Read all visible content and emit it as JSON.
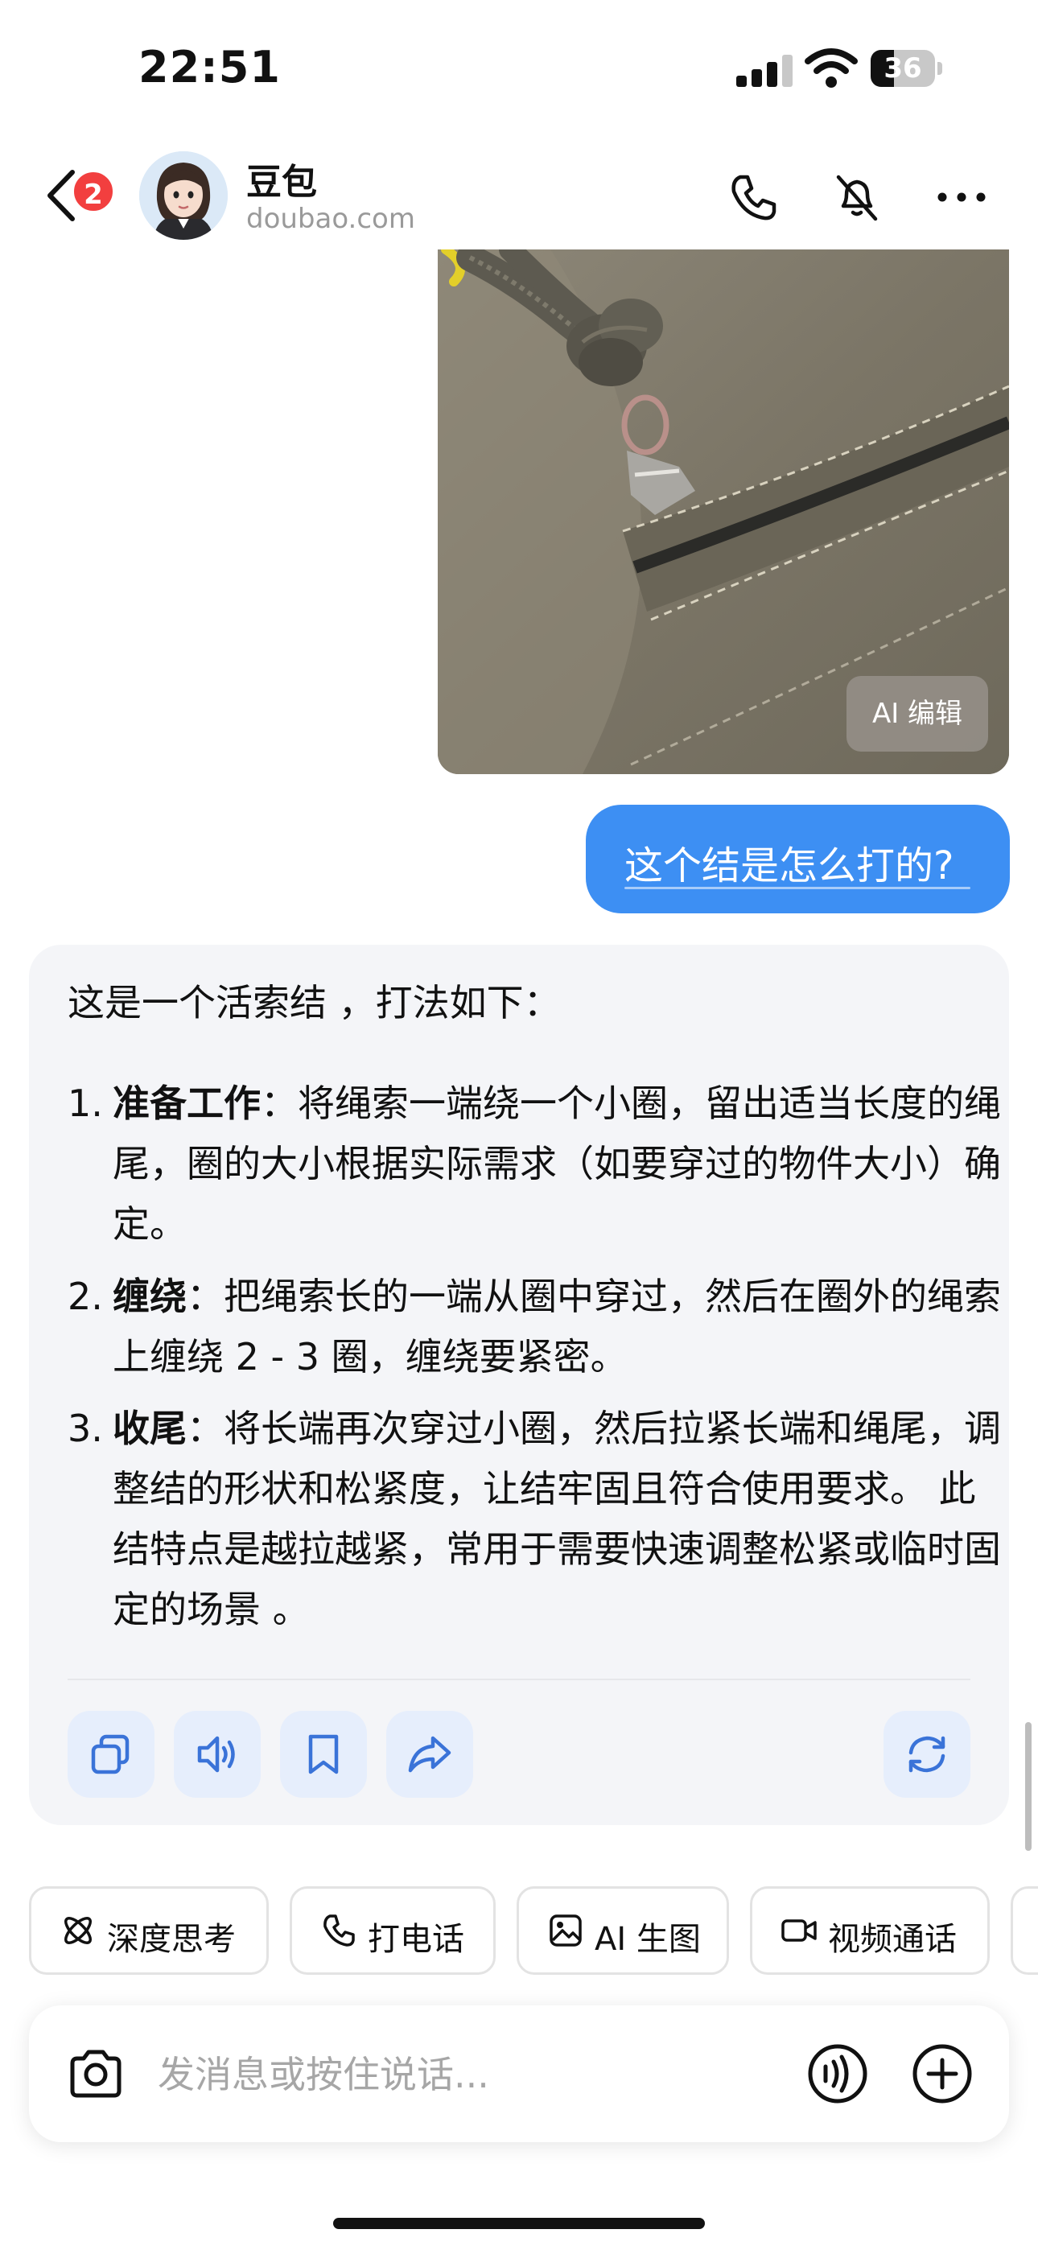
{
  "status_bar": {
    "time": "22:51",
    "battery_level": "36",
    "icons": [
      "signal-icon",
      "wifi-icon",
      "battery-icon"
    ]
  },
  "header": {
    "back_icon": "chevron-left-icon",
    "unread_count": "2",
    "title": "豆包",
    "subtitle": "doubao.com",
    "actions": [
      "phone-icon",
      "mute-icon",
      "more-icon"
    ]
  },
  "image_message": {
    "ai_edit_label": "AI 编辑"
  },
  "user_message": {
    "text": "这个结是怎么打的?"
  },
  "assistant_message": {
    "intro": "这是一个活索结 ，打法如下：",
    "steps": [
      {
        "num": "1.",
        "title": "准备工作",
        "text": "：将绳索一端绕一个小圈，留出适当长度的绳尾，圈的大小根据实际需求（如要穿过的物件大小）确定。"
      },
      {
        "num": "2.",
        "title": "缠绕",
        "text": "：把绳索长的一端从圈中穿过，然后在圈外的绳索上缠绕 2 - 3 圈，缠绕要紧密。"
      },
      {
        "num": "3.",
        "title": "收尾",
        "text": "：将长端再次穿过小圈，然后拉紧长端和绳尾，调整结的形状和松紧度，让结牢固且符合使用要求。 此结特点是越拉越紧，常用于需要快速调整松紧或临时固定的场景 。"
      }
    ],
    "actions": [
      "copy-icon",
      "speaker-icon",
      "bookmark-icon",
      "share-icon",
      "regenerate-icon"
    ]
  },
  "quick_actions": [
    {
      "label": "深度思考",
      "icon": "atom-icon"
    },
    {
      "label": "打电话",
      "icon": "phone-icon"
    },
    {
      "label": "AI 生图",
      "icon": "image-icon"
    },
    {
      "label": "视频通话",
      "icon": "video-icon"
    }
  ],
  "composer": {
    "placeholder": "发消息或按住说话...",
    "icons": [
      "camera-icon",
      "voice-icon",
      "plus-icon"
    ]
  },
  "colors": {
    "accent": "#3d8ff3",
    "badge": "#f23f3f",
    "card_bg": "#f4f5f8",
    "action_bg": "#e6eefc",
    "action_icon": "#3a73d8"
  }
}
